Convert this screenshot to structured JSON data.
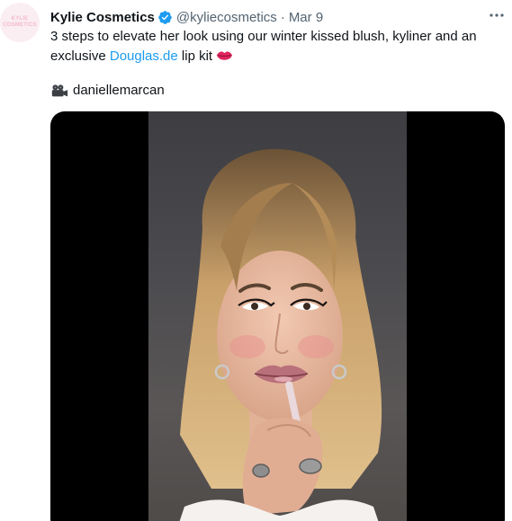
{
  "author": {
    "display_name": "Kylie Cosmetics",
    "handle": "@kyliecosmetics",
    "separator": "·",
    "date": "Mar 9",
    "avatar_text": [
      "KYLIE",
      "COSMETICS"
    ]
  },
  "tweet": {
    "text_before": "3 steps to elevate her look using our winter kissed blush, kyliner and an exclusive ",
    "link_text": "Douglas.de",
    "text_after": " lip kit ",
    "credit_name": "daniellemarcan"
  },
  "icons": {
    "verified": "verified-badge-icon",
    "more": "more-options-icon",
    "lips": "lips-emoji-icon",
    "camera": "movie-camera-emoji-icon"
  },
  "colors": {
    "link": "#1d9bf0",
    "muted": "#536471",
    "verified": "#1d9bf0",
    "lips": "#e0245e"
  }
}
